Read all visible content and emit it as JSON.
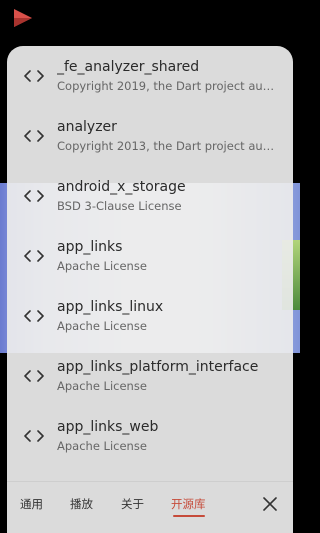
{
  "colors": {
    "accent": "#c64b3a",
    "sheet_bg": "#ececec",
    "title_text": "#2b2b2b",
    "subtitle_text": "#666666"
  },
  "header": {
    "logo_icon": "app-logo-icon"
  },
  "packages": [
    {
      "name": "_fe_analyzer_shared",
      "license": "Copyright 2019, the Dart project authors.",
      "icon": "code-icon"
    },
    {
      "name": "analyzer",
      "license": "Copyright 2013, the Dart project authors.",
      "icon": "code-icon"
    },
    {
      "name": "android_x_storage",
      "license": "BSD 3-Clause License",
      "icon": "code-icon"
    },
    {
      "name": "app_links",
      "license": "Apache License",
      "icon": "code-icon"
    },
    {
      "name": "app_links_linux",
      "license": "Apache License",
      "icon": "code-icon"
    },
    {
      "name": "app_links_platform_interface",
      "license": "Apache License",
      "icon": "code-icon"
    },
    {
      "name": "app_links_web",
      "license": "Apache License",
      "icon": "code-icon"
    }
  ],
  "tabs": [
    {
      "label": "通用",
      "active": false
    },
    {
      "label": "播放",
      "active": false
    },
    {
      "label": "关于",
      "active": false
    },
    {
      "label": "开源库",
      "active": true
    }
  ],
  "close_icon": "close-icon"
}
